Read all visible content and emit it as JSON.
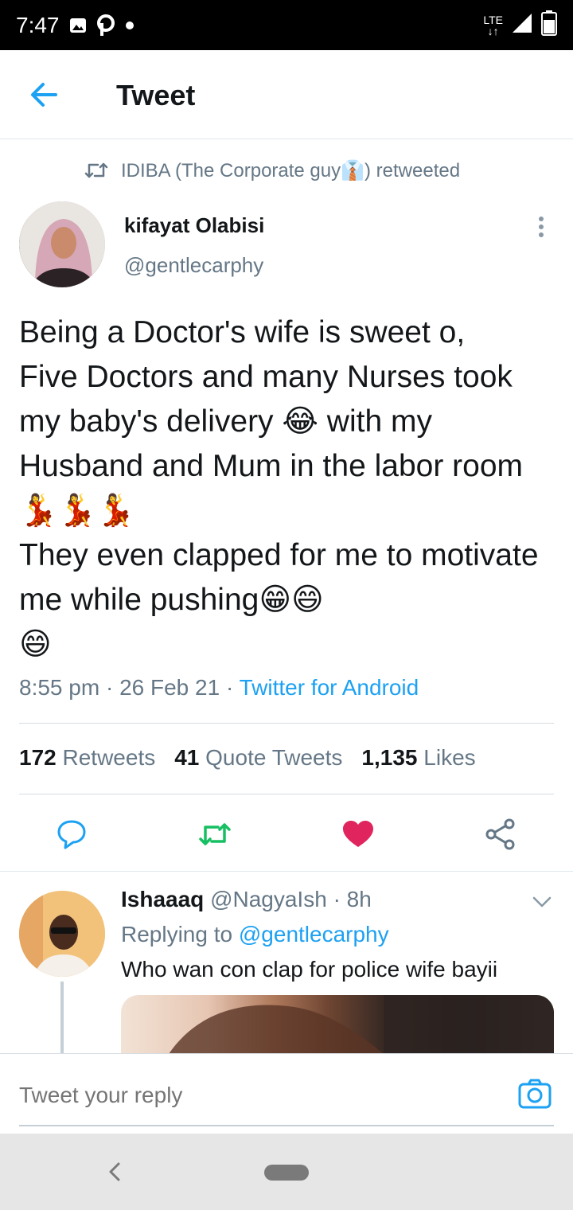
{
  "status_bar": {
    "time": "7:47",
    "network": "LTE",
    "icons": [
      "image-icon",
      "pinterest-icon",
      "dot-icon",
      "signal-icon",
      "battery-icon"
    ]
  },
  "header": {
    "title": "Tweet"
  },
  "retweet_line": {
    "text": "IDIBA (The Corporate guy👔) retweeted"
  },
  "tweet": {
    "author_name": "kifayat Olabisi",
    "author_handle": "@gentlecarphy",
    "text": "Being a Doctor's wife is sweet o,\nFive Doctors and many Nurses took my baby's delivery 😂 with my Husband and Mum in the labor room 💃💃💃\nThey even clapped for me to motivate me while pushing😁😄\n😄",
    "time": "8:55 pm",
    "date": "26 Feb 21",
    "source": "Twitter for Android",
    "retweets_count": "172",
    "retweets_label": "Retweets",
    "quotes_count": "41",
    "quotes_label": "Quote Tweets",
    "likes_count": "1,135",
    "likes_label": "Likes",
    "liked": true,
    "colors": {
      "accent": "#1da1f2",
      "retweet": "#17bf63",
      "like": "#e0245e",
      "muted": "#657786"
    }
  },
  "reply": {
    "author_name": "Ishaaaq",
    "author_handle": "@NagyaIsh",
    "age": "8h",
    "replying_prefix": "Replying to",
    "replying_to": "@gentlecarphy",
    "text": "Who wan con clap for police wife bayii"
  },
  "compose": {
    "placeholder": "Tweet your reply"
  }
}
